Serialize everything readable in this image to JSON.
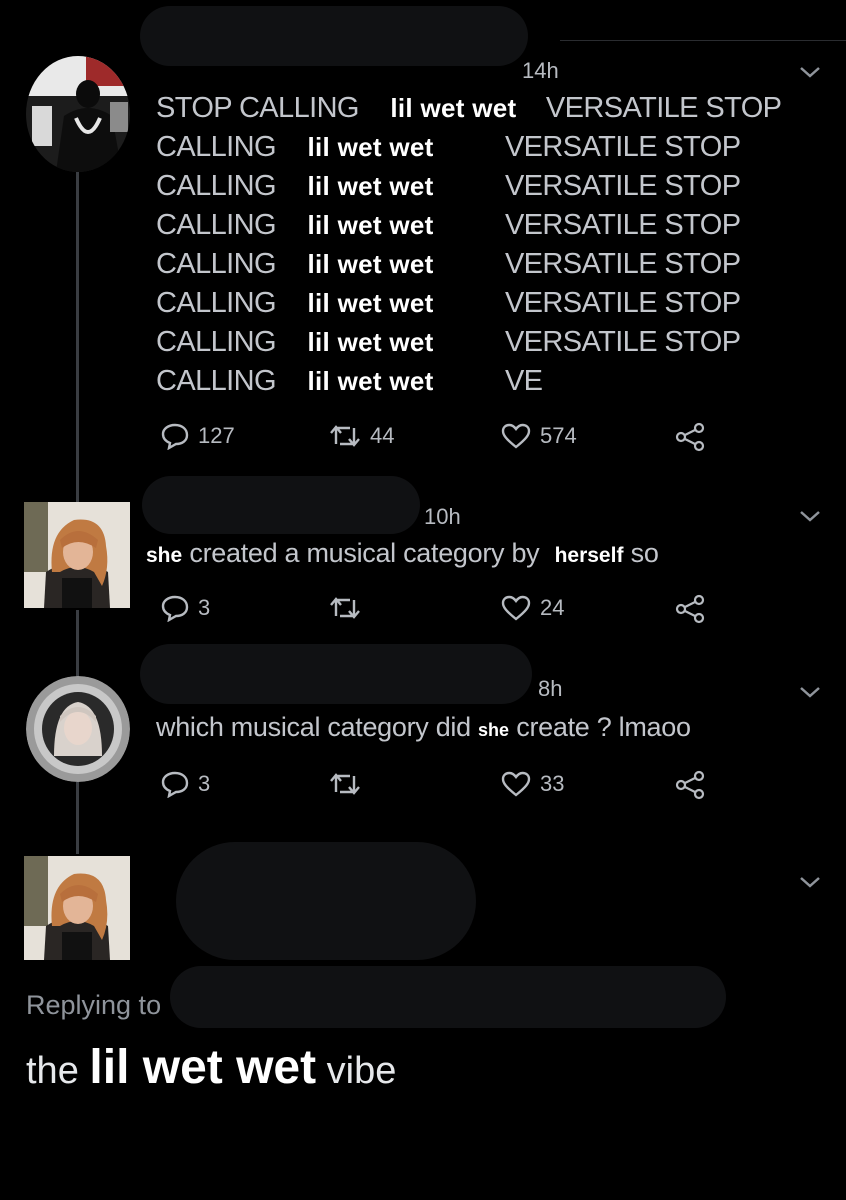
{
  "tweet1": {
    "time": "14h",
    "lines": [
      {
        "a": "STOP CALLING",
        "b": "lil wet wet",
        "c": "VERSATILE STOP"
      },
      {
        "a": "CALLING",
        "b": "lil wet wet",
        "c": "VERSATILE STOP"
      },
      {
        "a": "CALLING",
        "b": "lil wet wet",
        "c": "VERSATILE STOP"
      },
      {
        "a": "CALLING",
        "b": "lil wet wet",
        "c": "VERSATILE STOP"
      },
      {
        "a": "CALLING",
        "b": "lil wet wet",
        "c": "VERSATILE STOP"
      },
      {
        "a": "CALLING",
        "b": "lil wet wet",
        "c": "VERSATILE STOP"
      },
      {
        "a": "CALLING",
        "b": "lil wet wet",
        "c": "VERSATILE STOP"
      },
      {
        "a": "CALLING",
        "b": "lil wet wet",
        "c": "VE"
      }
    ],
    "replies": "127",
    "retweets": "44",
    "likes": "574"
  },
  "tweet2": {
    "time": "10h",
    "text_a": "she",
    "text_b": " created a musical category by ",
    "text_c": "herself",
    "text_d": " so",
    "replies": "3",
    "retweets": "",
    "likes": "24"
  },
  "tweet3": {
    "time": "8h",
    "text_a": "which musical category did ",
    "text_b": "she",
    "text_c": " create ? lmaoo",
    "replies": "3",
    "retweets": "",
    "likes": "33"
  },
  "tweet4": {
    "replying_label": "Replying to",
    "text_a": "the ",
    "text_b": "lil wet wet",
    "text_c": " vibe"
  },
  "colors": {
    "background": "#000000",
    "text": "#c3c6cc",
    "overlay_text": "#ffffff",
    "icon": "#b7bbc1"
  },
  "icons": [
    "chevron-down-icon",
    "reply-icon",
    "retweet-icon",
    "like-icon",
    "share-icon"
  ]
}
